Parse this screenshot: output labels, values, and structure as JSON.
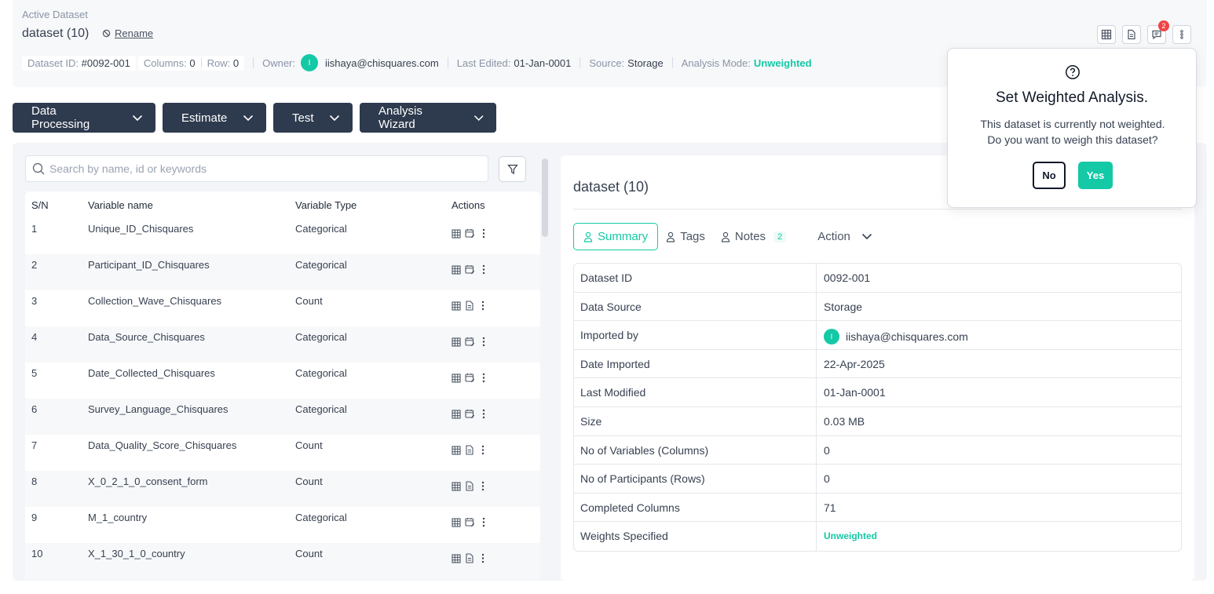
{
  "header": {
    "active_label": "Active Dataset",
    "title": "dataset (10)",
    "rename": "Rename",
    "meta": {
      "dataset_id_label": "Dataset ID:",
      "dataset_id": "#0092-001",
      "columns_label": "Columns:",
      "columns": "0",
      "row_label": "Row:",
      "row": "0",
      "owner_label": "Owner:",
      "owner_initial": "I",
      "owner": "iishaya@chisquares.com",
      "last_edited_label": "Last Edited:",
      "last_edited": "01-Jan-0001",
      "source_label": "Source:",
      "source": "Storage",
      "mode_label": "Analysis Mode:",
      "mode": "Unweighted"
    },
    "notification_count": "2"
  },
  "toolbar": {
    "buttons": [
      "Data Processing",
      "Estimate",
      "Test",
      "Analysis Wizard"
    ]
  },
  "search": {
    "placeholder": "Search by name, id or keywords"
  },
  "variables": {
    "headers": [
      "S/N",
      "Variable name",
      "Variable Type",
      "Actions"
    ],
    "rows": [
      {
        "sn": "1",
        "name": "Unique_ID_Chisquares",
        "type": "Categorical"
      },
      {
        "sn": "2",
        "name": "Participant_ID_Chisquares",
        "type": "Categorical"
      },
      {
        "sn": "3",
        "name": "Collection_Wave_Chisquares",
        "type": "Count"
      },
      {
        "sn": "4",
        "name": "Data_Source_Chisquares",
        "type": "Categorical"
      },
      {
        "sn": "5",
        "name": "Date_Collected_Chisquares",
        "type": "Categorical"
      },
      {
        "sn": "6",
        "name": "Survey_Language_Chisquares",
        "type": "Categorical"
      },
      {
        "sn": "7",
        "name": "Data_Quality_Score_Chisquares",
        "type": "Count"
      },
      {
        "sn": "8",
        "name": "X_0_2_1_0_consent_form",
        "type": "Count"
      },
      {
        "sn": "9",
        "name": "M_1_country",
        "type": "Categorical"
      },
      {
        "sn": "10",
        "name": "X_1_30_1_0_country",
        "type": "Count"
      }
    ]
  },
  "panel": {
    "title": "dataset (10)",
    "tabs": [
      "Summary",
      "Tags",
      "Notes"
    ],
    "notes_count": "2",
    "action": "Action",
    "summary": [
      {
        "key": "Dataset ID",
        "value": "0092-001"
      },
      {
        "key": "Data Source",
        "value": "Storage"
      },
      {
        "key": "Imported by",
        "value": "iishaya@chisquares.com",
        "initial": "I"
      },
      {
        "key": "Date Imported",
        "value": "22-Apr-2025"
      },
      {
        "key": "Last Modified",
        "value": "01-Jan-0001"
      },
      {
        "key": "Size",
        "value": "0.03 MB"
      },
      {
        "key": "No of Variables (Columns)",
        "value": "0"
      },
      {
        "key": "No of Participants (Rows)",
        "value": "0"
      },
      {
        "key": "Completed Columns",
        "value": "71"
      },
      {
        "key": "Weights Specified",
        "value": "Unweighted"
      }
    ]
  },
  "popup": {
    "title": "Set Weighted Analysis.",
    "message_line1": "This dataset is currently not weighted.",
    "message_line2": "Do you want to weigh this dataset?",
    "no": "No",
    "yes": "Yes"
  },
  "colors": {
    "accent": "#14c9a5",
    "toolbar": "#2e3a4e",
    "badge": "#ef4444"
  }
}
